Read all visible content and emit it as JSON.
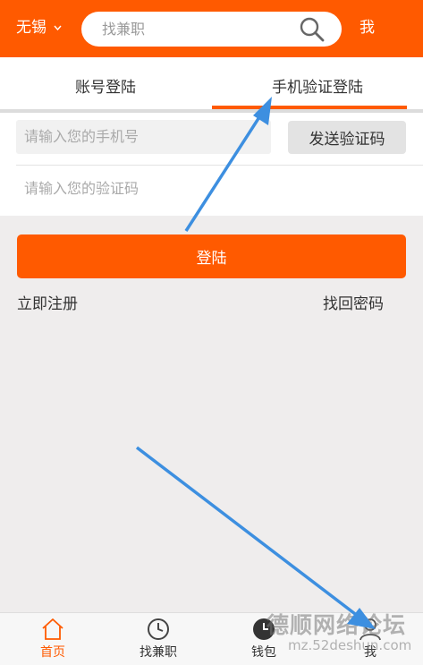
{
  "header": {
    "city": "无锡",
    "search_placeholder": "找兼职",
    "me_label": "我"
  },
  "tabs": [
    {
      "label": "账号登陆",
      "active": false
    },
    {
      "label": "手机验证登陆",
      "active": true
    }
  ],
  "form": {
    "phone_placeholder": "请输入您的手机号",
    "send_code_label": "发送验证码",
    "code_placeholder": "请输入您的验证码"
  },
  "login_label": "登陆",
  "links": {
    "register": "立即注册",
    "forgot": "找回密码"
  },
  "bottom_nav": [
    {
      "label": "首页",
      "icon": "home-icon",
      "active": true
    },
    {
      "label": "找兼职",
      "icon": "clock-icon",
      "active": false
    },
    {
      "label": "钱包",
      "icon": "wallet-icon",
      "active": false
    },
    {
      "label": "我",
      "icon": "user-icon",
      "active": false
    }
  ],
  "watermark": {
    "text": "德顺网络论坛",
    "url": "mz.52deshun.com"
  },
  "colors": {
    "accent": "#ff5a00",
    "annotation_arrow": "#3d8fe0"
  }
}
